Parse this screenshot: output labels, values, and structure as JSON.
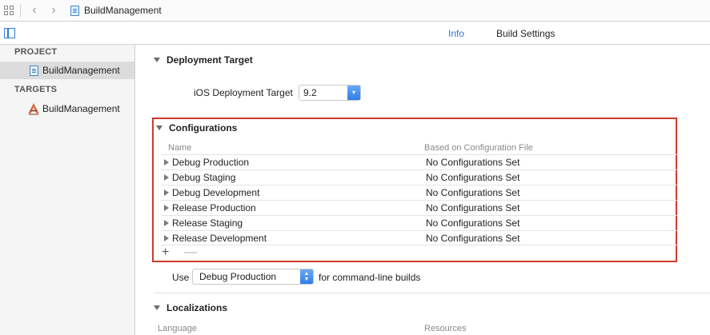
{
  "jumpbar": {
    "title": "BuildManagement",
    "back_arrow": "‹",
    "forward_arrow": "›"
  },
  "tabs": {
    "info": "Info",
    "build_settings": "Build Settings"
  },
  "sidebar": {
    "project_header": "PROJECT",
    "project_item": "BuildManagement",
    "targets_header": "TARGETS",
    "target_item": "BuildManagement"
  },
  "deployment": {
    "section_title": "Deployment Target",
    "label": "iOS Deployment Target",
    "value": "9.2"
  },
  "configurations": {
    "section_title": "Configurations",
    "col_name": "Name",
    "col_based_on": "Based on Configuration File",
    "rows": [
      {
        "name": "Debug Production",
        "based_on": "No Configurations Set"
      },
      {
        "name": "Debug Staging",
        "based_on": "No Configurations Set"
      },
      {
        "name": "Debug Development",
        "based_on": "No Configurations Set"
      },
      {
        "name": "Release Production",
        "based_on": "No Configurations Set"
      },
      {
        "name": "Release Staging",
        "based_on": "No Configurations Set"
      },
      {
        "name": "Release Development",
        "based_on": "No Configurations Set"
      }
    ],
    "add_symbol": "+",
    "remove_symbol": "—",
    "highlight_color": "#d03a2f"
  },
  "command_line": {
    "prefix": "Use",
    "selected": "Debug Production",
    "suffix": "for command-line builds"
  },
  "localizations": {
    "section_title": "Localizations",
    "col_language": "Language",
    "col_resources": "Resources"
  },
  "colors": {
    "accent": "#2a78d6",
    "selected_row": "#dcdcdc"
  }
}
